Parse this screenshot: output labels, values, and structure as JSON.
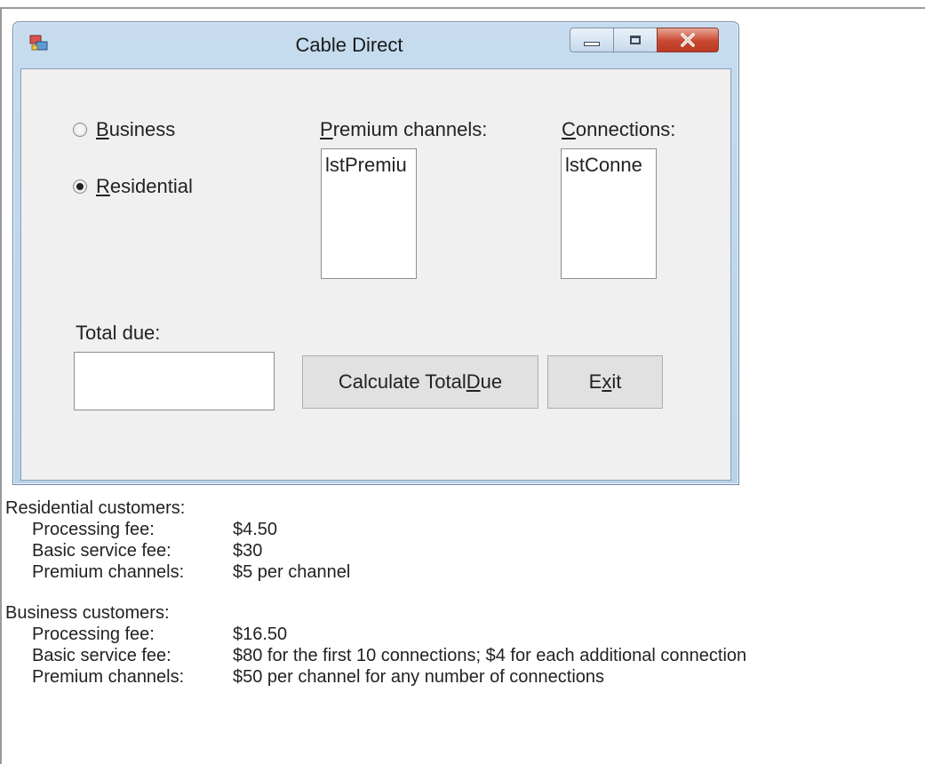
{
  "window": {
    "title": "Cable Direct",
    "controls": [
      "minimize",
      "maximize",
      "close"
    ]
  },
  "form": {
    "radio_business": {
      "pre": "",
      "key": "B",
      "post": "usiness",
      "selected": false
    },
    "radio_residential": {
      "pre": "",
      "key": "R",
      "post": "esidential",
      "selected": true
    },
    "premium_label": {
      "pre": "",
      "key": "P",
      "post": "remium channels:"
    },
    "connections_label": {
      "pre": "",
      "key": "C",
      "post": "onnections:"
    },
    "premium_list_text": "lstPremiu",
    "connections_list_text": "lstConne",
    "total_label": "Total due:",
    "total_value": "",
    "calc_button": {
      "pre": "Calculate Total ",
      "key": "D",
      "post": "ue"
    },
    "exit_button": {
      "pre": "E",
      "key": "x",
      "post": "it"
    }
  },
  "fees": {
    "residential": {
      "heading": "Residential customers:",
      "rows": [
        {
          "label": "Processing fee:",
          "value": "$4.50"
        },
        {
          "label": "Basic service fee:",
          "value": "$30"
        },
        {
          "label": "Premium channels:",
          "value": "$5 per channel"
        }
      ]
    },
    "business": {
      "heading": "Business customers:",
      "rows": [
        {
          "label": "Processing fee:",
          "value": "$16.50"
        },
        {
          "label": "Basic service fee:",
          "value": "$80 for the first 10 connections; $4 for each additional connection"
        },
        {
          "label": "Premium channels:",
          "value": "$50 per channel for any number of connections"
        }
      ]
    }
  },
  "colors": {
    "titlebar": "#c6dcee",
    "client": "#f0f0f0",
    "close_button": "#c9482f"
  }
}
